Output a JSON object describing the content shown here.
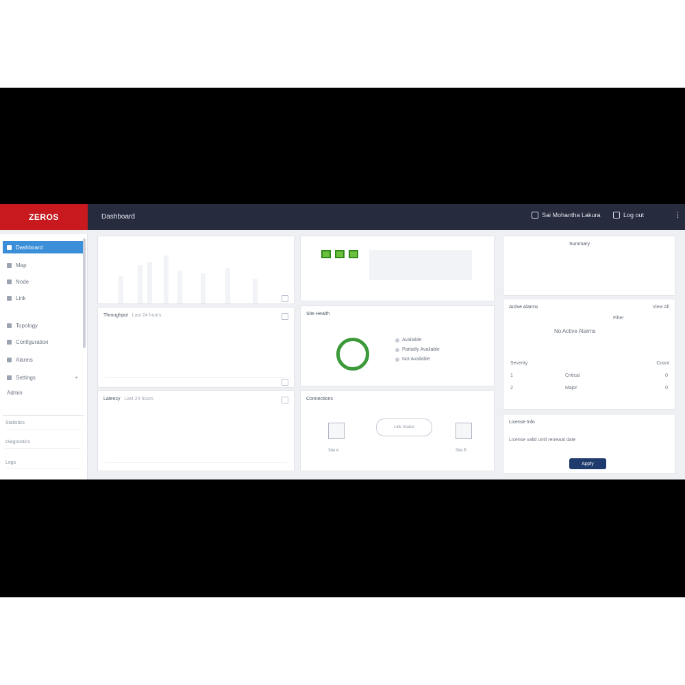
{
  "topbar": {
    "logo": "ZEROS",
    "title": "Dashboard",
    "user": "Sai Mohantha Lakura",
    "status": "Log out",
    "more": "⋮"
  },
  "sidebar": {
    "items": [
      {
        "label": "Dashboard",
        "active": true
      },
      {
        "label": "Map",
        "active": false
      },
      {
        "label": "Node",
        "active": false
      },
      {
        "label": "Link",
        "active": false
      },
      {
        "label": "Topology",
        "active": false
      },
      {
        "label": "Configuration",
        "active": false
      },
      {
        "label": "Alarms",
        "active": false
      },
      {
        "label": "Settings",
        "active": false,
        "badge": "▸"
      },
      {
        "label": "Admin",
        "active": false
      }
    ],
    "sub_items": [
      "Statistics",
      "Diagnostics",
      "Logs"
    ]
  },
  "cards": {
    "throughput": {
      "title": "Throughput",
      "subtitle": "Last 24 hours"
    },
    "latency": {
      "title": "Latency",
      "subtitle": "Last 24 hours"
    },
    "health": {
      "title": "Site Health"
    },
    "health_legend": [
      "Available",
      "Partially Available",
      "Not Available"
    ],
    "connections": {
      "title": "Connections"
    },
    "node_a": "Site A",
    "node_b": "Site B",
    "link_label": "Link Status",
    "right_top_title": "Summary",
    "alarms": {
      "title": "Active Alarms",
      "action": "View All"
    },
    "alarm_filter": "Filter",
    "alarm_center": "No Active Alarms",
    "alarm_rows": [
      {
        "id": "1",
        "name": "Critical",
        "count": "0"
      },
      {
        "id": "2",
        "name": "Major",
        "count": "0"
      }
    ],
    "alarm_header_left": "Severity",
    "alarm_header_right": "Count",
    "license": {
      "title": "License Info",
      "text": "License valid until renewal date"
    },
    "apply_label": "Apply"
  }
}
